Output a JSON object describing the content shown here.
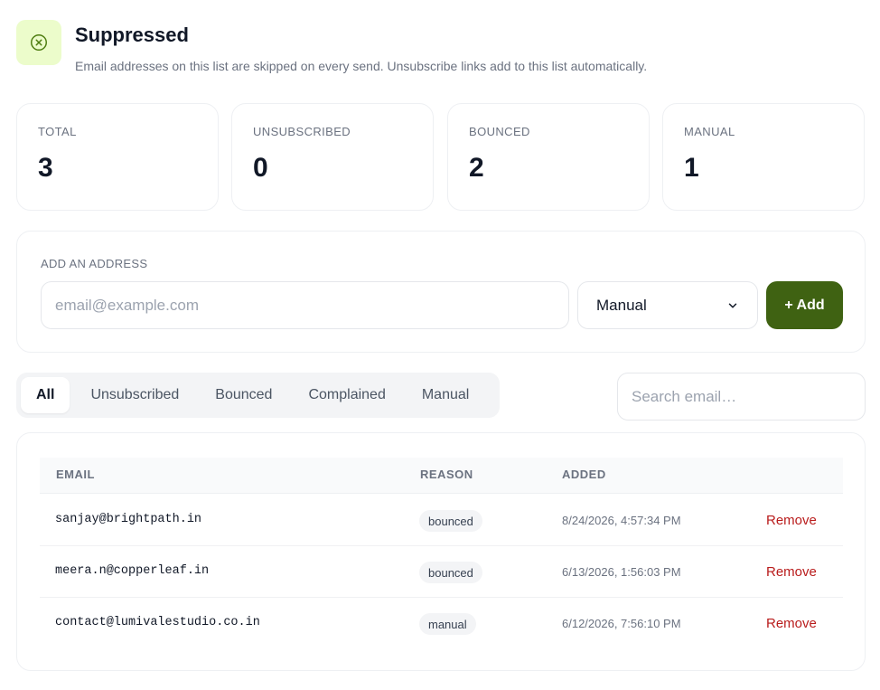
{
  "header": {
    "icon": "x-circle-icon",
    "title": "Suppressed",
    "subtitle": "Email addresses on this list are skipped on every send. Unsubscribe links add to this list automatically."
  },
  "stats": [
    {
      "label": "TOTAL",
      "value": "3"
    },
    {
      "label": "UNSUBSCRIBED",
      "value": "0"
    },
    {
      "label": "BOUNCED",
      "value": "2"
    },
    {
      "label": "MANUAL",
      "value": "1"
    }
  ],
  "add_form": {
    "label": "ADD AN ADDRESS",
    "email_placeholder": "email@example.com",
    "email_value": "",
    "reason_selected": "Manual",
    "add_button_label": "+ Add"
  },
  "filters": {
    "tabs": [
      "All",
      "Unsubscribed",
      "Bounced",
      "Complained",
      "Manual"
    ],
    "active": "All",
    "search_placeholder": "Search email…"
  },
  "table": {
    "headers": {
      "email": "EMAIL",
      "reason": "REASON",
      "added": "ADDED"
    },
    "rows": [
      {
        "email": "sanjay@brightpath.in",
        "reason": "bounced",
        "added": "8/24/2026, 4:57:34 PM",
        "action": "Remove"
      },
      {
        "email": "meera.n@copperleaf.in",
        "reason": "bounced",
        "added": "6/13/2026, 1:56:03 PM",
        "action": "Remove"
      },
      {
        "email": "contact@lumivalestudio.co.in",
        "reason": "manual",
        "added": "6/12/2026, 7:56:10 PM",
        "action": "Remove"
      }
    ]
  },
  "colors": {
    "accent": "#3f6212",
    "icon_bg": "#ecfccb",
    "danger": "#b91c1c"
  }
}
